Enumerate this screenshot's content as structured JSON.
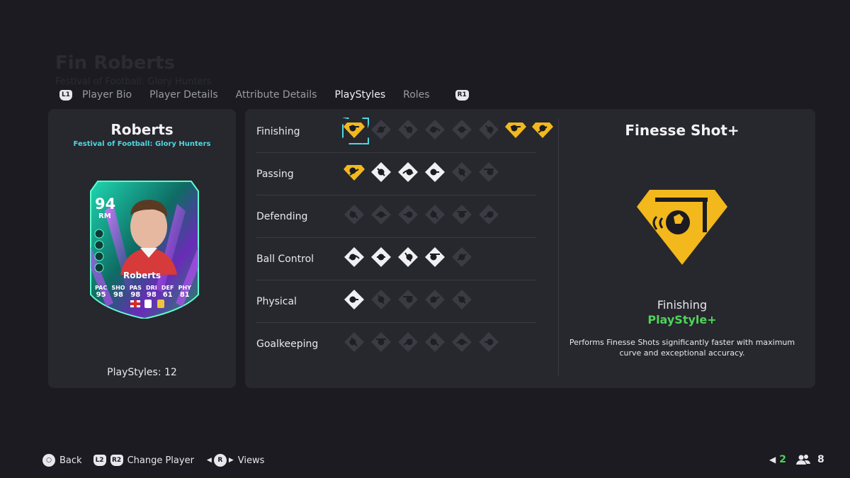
{
  "background": {
    "player_full_name": "Fin Roberts",
    "promo": "Festival of Football: Glory Hunters"
  },
  "tabs": {
    "left_button": "L1",
    "right_button": "R1",
    "items": [
      "Player Bio",
      "Player Details",
      "Attribute Details",
      "PlayStyles",
      "Roles"
    ],
    "active": "PlayStyles"
  },
  "player": {
    "name": "Roberts",
    "promo": "Festival of Football: Glory Hunters",
    "card": {
      "rating": "94",
      "position": "RM",
      "name": "Roberts",
      "stats": [
        {
          "label": "PAC",
          "value": "95"
        },
        {
          "label": "SHO",
          "value": "98"
        },
        {
          "label": "PAS",
          "value": "98"
        },
        {
          "label": "DRI",
          "value": "98"
        },
        {
          "label": "DEF",
          "value": "61"
        },
        {
          "label": "PHY",
          "value": "81"
        }
      ]
    },
    "playstyles_count": "PlayStyles: 12"
  },
  "categories": [
    {
      "label": "Finishing",
      "icons": [
        {
          "name": "finesse-shot",
          "state": "plus",
          "selected": true
        },
        {
          "name": "chip-shot",
          "state": "off"
        },
        {
          "name": "power-shot",
          "state": "off"
        },
        {
          "name": "dead-ball",
          "state": "off"
        },
        {
          "name": "power-header",
          "state": "off"
        },
        {
          "name": "acrobatic",
          "state": "off"
        },
        {
          "name": "low-driven-shot",
          "state": "plus"
        },
        {
          "name": "trivela",
          "state": "plus"
        }
      ]
    },
    {
      "label": "Passing",
      "icons": [
        {
          "name": "incisive-pass",
          "state": "plus"
        },
        {
          "name": "pinged-pass",
          "state": "on"
        },
        {
          "name": "long-ball-pass",
          "state": "on"
        },
        {
          "name": "tiki-taka",
          "state": "on"
        },
        {
          "name": "whipped-pass",
          "state": "off"
        },
        {
          "name": "inventive",
          "state": "off"
        }
      ]
    },
    {
      "label": "Defending",
      "icons": [
        {
          "name": "jockey",
          "state": "off"
        },
        {
          "name": "block",
          "state": "off"
        },
        {
          "name": "intercept",
          "state": "off"
        },
        {
          "name": "anticipate",
          "state": "off"
        },
        {
          "name": "slide-tackle",
          "state": "off"
        },
        {
          "name": "aerial-fortress",
          "state": "off"
        }
      ]
    },
    {
      "label": "Ball Control",
      "icons": [
        {
          "name": "technical",
          "state": "on"
        },
        {
          "name": "rapid",
          "state": "on"
        },
        {
          "name": "first-touch",
          "state": "on"
        },
        {
          "name": "flair",
          "state": "on"
        },
        {
          "name": "press-proven",
          "state": "off"
        }
      ]
    },
    {
      "label": "Physical",
      "icons": [
        {
          "name": "quick-step",
          "state": "on"
        },
        {
          "name": "relentless",
          "state": "off"
        },
        {
          "name": "trickster",
          "state": "off"
        },
        {
          "name": "long-throw",
          "state": "off"
        },
        {
          "name": "bruiser",
          "state": "off"
        }
      ]
    },
    {
      "label": "Goalkeeping",
      "icons": [
        {
          "name": "far-throw",
          "state": "off"
        },
        {
          "name": "footwork",
          "state": "off"
        },
        {
          "name": "cross-claimer",
          "state": "off"
        },
        {
          "name": "rush-out",
          "state": "off"
        },
        {
          "name": "far-reach",
          "state": "off"
        },
        {
          "name": "deflector",
          "state": "off"
        }
      ]
    }
  ],
  "detail": {
    "title": "Finesse Shot+",
    "category": "Finishing",
    "type": "PlayStyle+",
    "description": "Performs Finesse Shots significantly faster with maximum curve and exceptional accuracy."
  },
  "footer": {
    "back_button": "○",
    "back": "Back",
    "l2": "L2",
    "r2": "R2",
    "change_player": "Change Player",
    "r_button": "R",
    "views": "Views"
  },
  "status": {
    "green_count": "2",
    "friends_count": "8"
  },
  "colors": {
    "accent_gold": "#f2b81c",
    "accent_cyan": "#4fd8e0",
    "playstyle_plus_green": "#4ed45a",
    "panel": "#27272e",
    "background": "#1b1b21"
  }
}
